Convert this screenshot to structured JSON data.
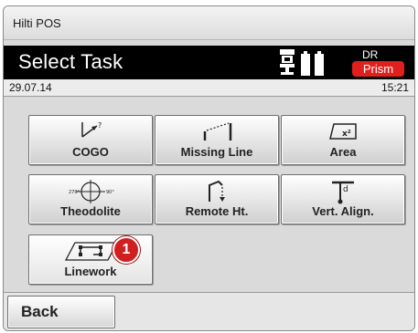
{
  "window": {
    "app_title": "Hilti POS"
  },
  "header": {
    "title": "Select Task",
    "instrument_icon": "total-station-icon",
    "battery_icon": "battery-icon",
    "measure_mode": "DR",
    "target_mode": "Prism",
    "target_color": "#e0201c"
  },
  "status": {
    "date": "29.07.14",
    "time": "15:21"
  },
  "tasks": [
    {
      "label": "COGO",
      "icon": "cogo-icon"
    },
    {
      "label": "Missing Line",
      "icon": "missing-line-icon"
    },
    {
      "label": "Area",
      "icon": "area-icon"
    },
    {
      "label": "Theodolite",
      "icon": "theodolite-icon"
    },
    {
      "label": "Remote Ht.",
      "icon": "remote-height-icon"
    },
    {
      "label": "Vert. Align.",
      "icon": "vertical-alignment-icon"
    },
    {
      "label": "Linework",
      "icon": "linework-icon"
    }
  ],
  "callout": {
    "number": "1",
    "color": "#cf1f1f"
  },
  "footer": {
    "back_label": "Back"
  }
}
